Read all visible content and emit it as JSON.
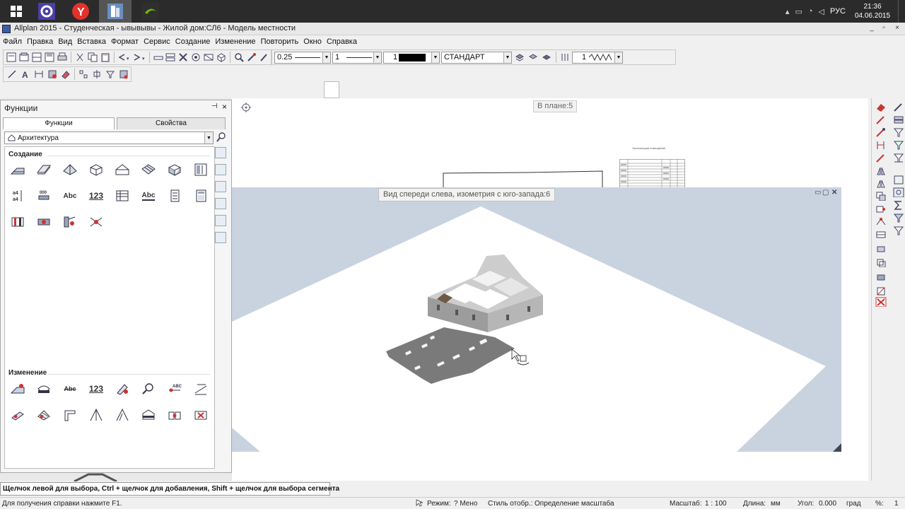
{
  "taskbar": {
    "start_icon": "windows-logo-icon",
    "apps": [
      "settings-gear-icon",
      "yandex-browser-icon",
      "allplan-icon",
      "nvidia-icon"
    ],
    "tray": {
      "language": "РУС",
      "time": "21:36",
      "date": "04.06.2015"
    }
  },
  "window": {
    "title": "Allplan 2015 - Студенческая - ывывывы - Жилой дом:СЛ6 - Модель местности",
    "controls": [
      "_",
      "▫",
      "×"
    ]
  },
  "menu": {
    "items": [
      "Файл",
      "Правка",
      "Вид",
      "Вставка",
      "Формат",
      "Сервис",
      "Создание",
      "Изменение",
      "Повторить",
      "Окно",
      "Справка"
    ]
  },
  "toolbar": {
    "pen_thickness": "0.25",
    "line_type": "1",
    "color": "1",
    "layer": "СТАНДАРТ",
    "hatch_value": "1"
  },
  "functions_panel": {
    "title": "Функции",
    "pin": "⊣",
    "close": "×",
    "tab_functions": "Функции",
    "tab_properties": "Свойства",
    "category": "Архитектура",
    "section_create": "Создание",
    "section_modify": "Изменение",
    "create_text_icons": {
      "abc_1": "Abc",
      "n123": "123",
      "abc_2": "Abc"
    },
    "modify_text_icons": {
      "abc": "Abc",
      "n123": "123"
    }
  },
  "views": {
    "plan_label": "В плане:5",
    "iso_label": "Вид спереди слева, изометрия с юго-запада:6",
    "table_title": "Экспликация помещений"
  },
  "status": {
    "prompt": "Щелчок левой для выбора, Ctrl + щелчок для добавления, Shift + щелчок для выбора сегмента",
    "help": "Для получения справки нажмите F1.",
    "mode_label": "Режим:",
    "mode_value": "? Мено",
    "display_style_label": "Стиль отобр.:",
    "scale_def": "Определение масштаба",
    "scale_label": "Масштаб:",
    "scale_value": "1 : 100",
    "length_label": "Длина:",
    "length_value": "мм",
    "angle_label": "Угол:",
    "angle_value": "0.000",
    "angle_unit": "град",
    "percent_label": "%:",
    "percent_value": "1"
  },
  "colors": {
    "taskbar": "#2b2b2b",
    "iso_background": "#c9d3e0",
    "building_wall": "#9c9c9c",
    "shadow": "#7a7a7a"
  }
}
